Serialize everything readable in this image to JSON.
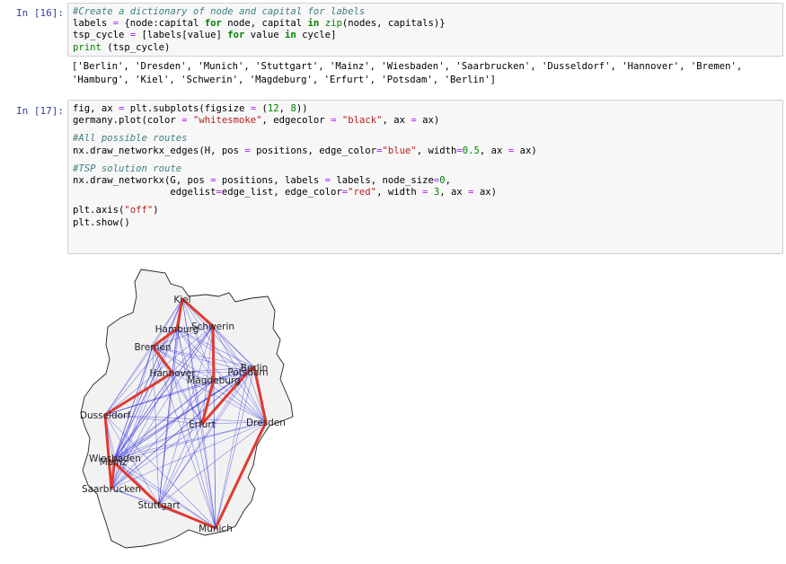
{
  "cell16": {
    "prompt": "In [16]:",
    "lines": [
      [
        {
          "t": "#Create a dictionary of node and capital for labels",
          "c": "cm"
        }
      ],
      [
        {
          "t": "labels ",
          "c": ""
        },
        {
          "t": "=",
          "c": "op"
        },
        {
          "t": " {node:capital ",
          "c": ""
        },
        {
          "t": "for",
          "c": "kw"
        },
        {
          "t": " node, capital ",
          "c": ""
        },
        {
          "t": "in",
          "c": "kw"
        },
        {
          "t": " ",
          "c": ""
        },
        {
          "t": "zip",
          "c": "bi"
        },
        {
          "t": "(nodes, capitals)}",
          "c": ""
        }
      ],
      [
        {
          "t": "tsp_cycle ",
          "c": ""
        },
        {
          "t": "=",
          "c": "op"
        },
        {
          "t": " [labels[value] ",
          "c": ""
        },
        {
          "t": "for",
          "c": "kw"
        },
        {
          "t": " value ",
          "c": ""
        },
        {
          "t": "in",
          "c": "kw"
        },
        {
          "t": " cycle]",
          "c": ""
        }
      ],
      [
        {
          "t": "print",
          "c": "bi"
        },
        {
          "t": " (tsp_cycle)",
          "c": ""
        }
      ]
    ],
    "output_lines": [
      "['Berlin', 'Dresden', 'Munich', 'Stuttgart', 'Mainz', 'Wiesbaden', 'Saarbrucken', 'Dusseldorf', 'Hannover', 'Bremen',",
      "'Hamburg', 'Kiel', 'Schwerin', 'Magdeburg', 'Erfurt', 'Potsdam', 'Berlin']"
    ]
  },
  "cell17": {
    "prompt": "In [17]:",
    "lines": [
      [
        {
          "t": "fig, ax ",
          "c": ""
        },
        {
          "t": "=",
          "c": "op"
        },
        {
          "t": " plt.subplots(figsize ",
          "c": ""
        },
        {
          "t": "=",
          "c": "op"
        },
        {
          "t": " (",
          "c": ""
        },
        {
          "t": "12",
          "c": "num"
        },
        {
          "t": ", ",
          "c": ""
        },
        {
          "t": "8",
          "c": "num"
        },
        {
          "t": "))",
          "c": ""
        }
      ],
      [
        {
          "t": "germany.plot(color ",
          "c": ""
        },
        {
          "t": "=",
          "c": "op"
        },
        {
          "t": " ",
          "c": ""
        },
        {
          "t": "\"whitesmoke\"",
          "c": "str"
        },
        {
          "t": ", edgecolor ",
          "c": ""
        },
        {
          "t": "=",
          "c": "op"
        },
        {
          "t": " ",
          "c": ""
        },
        {
          "t": "\"black\"",
          "c": "str"
        },
        {
          "t": ", ax ",
          "c": ""
        },
        {
          "t": "=",
          "c": "op"
        },
        {
          "t": " ax)",
          "c": ""
        }
      ],
      [],
      [
        {
          "t": "#All possible routes",
          "c": "cm"
        }
      ],
      [
        {
          "t": "nx.draw_networkx_edges(H, pos ",
          "c": ""
        },
        {
          "t": "=",
          "c": "op"
        },
        {
          "t": " positions, edge_color",
          "c": ""
        },
        {
          "t": "=",
          "c": "op"
        },
        {
          "t": "\"blue\"",
          "c": "str"
        },
        {
          "t": ", width",
          "c": ""
        },
        {
          "t": "=",
          "c": "op"
        },
        {
          "t": "0.5",
          "c": "num"
        },
        {
          "t": ", ax ",
          "c": ""
        },
        {
          "t": "=",
          "c": "op"
        },
        {
          "t": " ax)",
          "c": ""
        }
      ],
      [],
      [
        {
          "t": "#TSP solution route",
          "c": "cm"
        }
      ],
      [
        {
          "t": "nx.draw_networkx(G, pos ",
          "c": ""
        },
        {
          "t": "=",
          "c": "op"
        },
        {
          "t": " positions, labels ",
          "c": ""
        },
        {
          "t": "=",
          "c": "op"
        },
        {
          "t": " labels, node_size",
          "c": ""
        },
        {
          "t": "=",
          "c": "op"
        },
        {
          "t": "0",
          "c": "num"
        },
        {
          "t": ",",
          "c": ""
        }
      ],
      [
        {
          "t": "                 edgelist",
          "c": ""
        },
        {
          "t": "=",
          "c": "op"
        },
        {
          "t": "edge_list, edge_color",
          "c": ""
        },
        {
          "t": "=",
          "c": "op"
        },
        {
          "t": "\"red\"",
          "c": "str"
        },
        {
          "t": ", width ",
          "c": ""
        },
        {
          "t": "=",
          "c": "op"
        },
        {
          "t": " ",
          "c": ""
        },
        {
          "t": "3",
          "c": "num"
        },
        {
          "t": ", ax ",
          "c": ""
        },
        {
          "t": "=",
          "c": "op"
        },
        {
          "t": " ax)",
          "c": ""
        }
      ],
      [],
      [
        {
          "t": "plt.axis(",
          "c": ""
        },
        {
          "t": "\"off\"",
          "c": "str"
        },
        {
          "t": ")",
          "c": ""
        }
      ],
      [
        {
          "t": "plt.show()",
          "c": ""
        }
      ]
    ]
  },
  "plot": {
    "colors": {
      "map_fill": "#f2f2f2",
      "map_edge": "#222222",
      "all_edges": "#2222dd",
      "route": "#e03a2f"
    },
    "cities": [
      {
        "name": "Kiel"
      },
      {
        "name": "Hamburg"
      },
      {
        "name": "Schwerin"
      },
      {
        "name": "Bremen"
      },
      {
        "name": "Hannover"
      },
      {
        "name": "Potsdam"
      },
      {
        "name": "Berlin"
      },
      {
        "name": "Magdeburg"
      },
      {
        "name": "Dusseldorf"
      },
      {
        "name": "Erfurt"
      },
      {
        "name": "Dresden"
      },
      {
        "name": "Wiesbaden"
      },
      {
        "name": "Mainz"
      },
      {
        "name": "Saarbrucken"
      },
      {
        "name": "Stuttgart"
      },
      {
        "name": "Munich"
      }
    ],
    "route": [
      "Berlin",
      "Dresden",
      "Munich",
      "Stuttgart",
      "Mainz",
      "Wiesbaden",
      "Saarbrucken",
      "Dusseldorf",
      "Hannover",
      "Bremen",
      "Hamburg",
      "Kiel",
      "Schwerin",
      "Magdeburg",
      "Erfurt",
      "Potsdam",
      "Berlin"
    ]
  }
}
